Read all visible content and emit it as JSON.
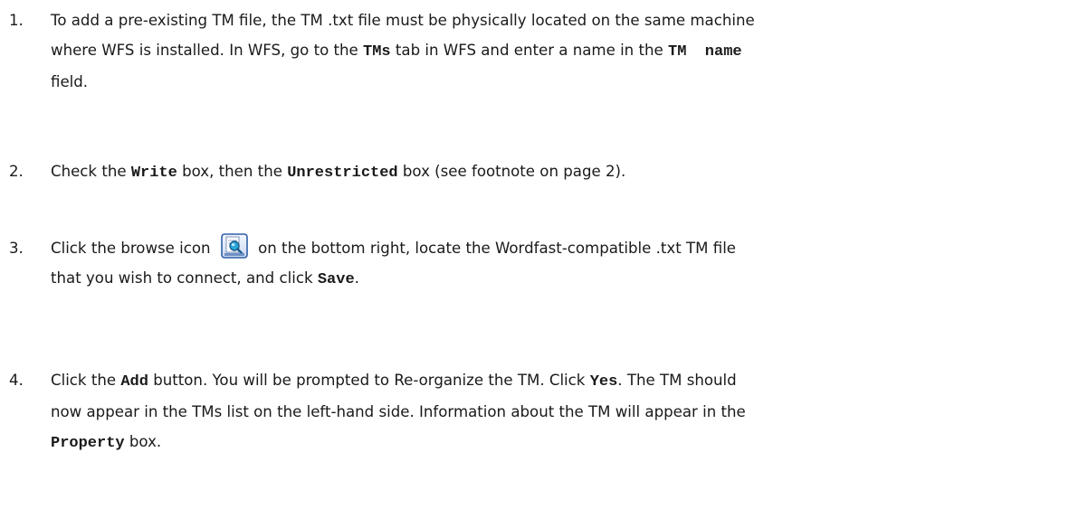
{
  "steps": [
    {
      "number": "1.",
      "t1": "To add a pre-existing TM file, the TM .txt file must be physically located on the same machine",
      "t2": "where WFS is installed.  In WFS, go to the ",
      "ui1": "TMs",
      "t3": " tab in WFS and enter a name in the ",
      "ui2": "TM  name",
      "t4": "field."
    },
    {
      "number": "2.",
      "t1": "Check the ",
      "ui1": "Write",
      "t2": " box, then the ",
      "ui2": "Unrestricted",
      "t3": " box (see footnote on page 2)."
    },
    {
      "number": "3.",
      "t1": "Click the browse icon ",
      "icon": "browse-icon",
      "t2": " on the bottom right, locate the Wordfast-compatible .txt TM file",
      "t3": "that you wish to connect, and click ",
      "ui1": "Save",
      "t4": "."
    },
    {
      "number": "4.",
      "t1": "Click the ",
      "ui1": "Add",
      "t2": " button. You will be prompted to Re-organize the TM.  Click ",
      "ui2": "Yes",
      "t3": ". The TM should",
      "t4": "now appear in the TMs list on the left-hand side. Information about the TM will appear in the",
      "ui3": "Property",
      "t5": " box."
    }
  ],
  "colors": {
    "text": "#1a1a1a",
    "icon_frame": "#2f5fa8",
    "icon_lens": "#2aa6d8"
  }
}
